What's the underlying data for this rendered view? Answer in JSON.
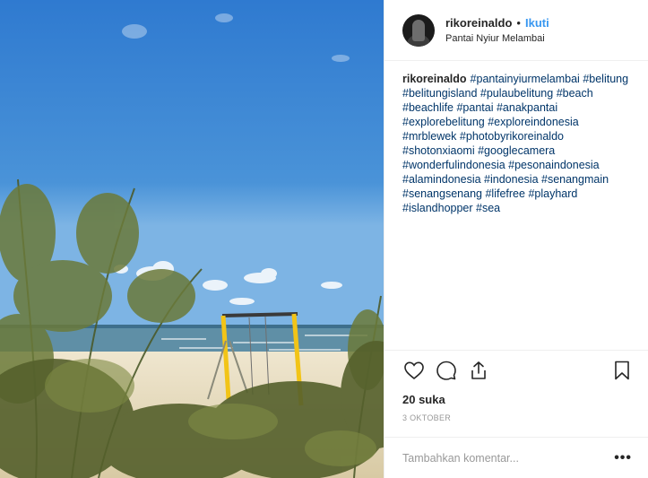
{
  "post": {
    "username": "rikoreinaldo",
    "separator": "•",
    "follow_label": "Ikuti",
    "location": "Pantai Nyiur Melambai",
    "caption_user": "rikoreinaldo",
    "hashtags": [
      "#pantainyiurmelambai",
      "#belitung",
      "#belitungisland",
      "#pulaubelitung",
      "#beach",
      "#beachlife",
      "#pantai",
      "#anakpantai",
      "#explorebelitung",
      "#exploreindonesia",
      "#mrblewek",
      "#photobyrikoreinaldo",
      "#shotonxiaomi",
      "#googlecamera",
      "#wonderfulindonesia",
      "#pesonaindonesia",
      "#alamindonesia",
      "#indonesia",
      "#senangmain",
      "#senangsenang",
      "#lifefree",
      "#playhard",
      "#islandhopper",
      "#sea"
    ],
    "likes": "20 suka",
    "date": "3 OKTOBER",
    "comment_placeholder": "Tambahkan komentar...",
    "more_label": "•••"
  },
  "icons": {
    "like": "heart-icon",
    "comment": "comment-icon",
    "share": "share-icon",
    "save": "bookmark-icon",
    "more": "more-options-icon"
  },
  "colors": {
    "follow": "#3897f0",
    "hashtag": "#003569",
    "sky": "#3d84cf",
    "sea": "#5e8fa8",
    "sand": "#e6dcc2",
    "swing_frame": "#f0c419"
  }
}
